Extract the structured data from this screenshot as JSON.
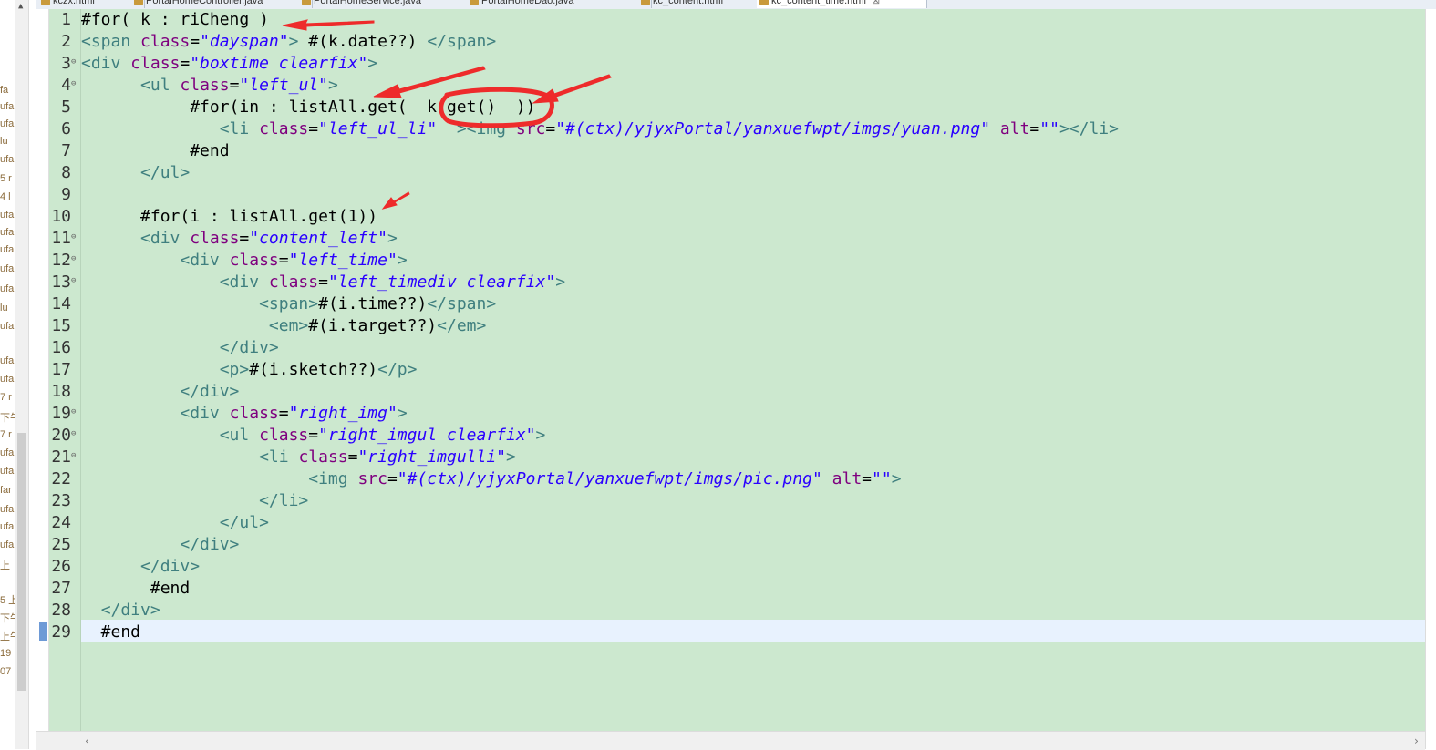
{
  "tabs": [
    {
      "label": "kczx.html",
      "active": false
    },
    {
      "label": "PortalHomeController.java",
      "active": false
    },
    {
      "label": "PortalHomeService.java",
      "active": false
    },
    {
      "label": "PortalHomeDao.java",
      "active": false
    },
    {
      "label": "kc_content.html",
      "active": false
    },
    {
      "label": "kc_content_time.html",
      "active": true
    }
  ],
  "left_strip_fragments": [
    "fa",
    "ufa",
    "ufa",
    "lu",
    "ufa",
    "5 r",
    "4 l",
    "ufa",
    "ufa",
    "ufa",
    "ufa",
    "ufa",
    "lu",
    "ufa",
    "ufa",
    "ufa",
    "7 r",
    "下午",
    "7 r",
    "ufa",
    "ufa",
    "far",
    "ufa",
    "ufa",
    "ufa",
    "上",
    "5 上",
    "下午",
    "上午",
    "19",
    "07"
  ],
  "editor": {
    "current_line": 29,
    "lines": [
      {
        "n": "1",
        "fold": "",
        "parts": [
          {
            "c": "plain",
            "t": "#for( k : riCheng )"
          }
        ]
      },
      {
        "n": "2",
        "fold": "",
        "parts": [
          {
            "c": "tag",
            "t": "<span "
          },
          {
            "c": "attr",
            "t": "class"
          },
          {
            "c": "plain",
            "t": "="
          },
          {
            "c": "str",
            "t": "\"dayspan\""
          },
          {
            "c": "tag",
            "t": ">"
          },
          {
            "c": "plain",
            "t": " #(k.date??) "
          },
          {
            "c": "tag",
            "t": "</span>"
          }
        ]
      },
      {
        "n": "3",
        "fold": "⊖",
        "parts": [
          {
            "c": "tag",
            "t": "<div "
          },
          {
            "c": "attr",
            "t": "class"
          },
          {
            "c": "plain",
            "t": "="
          },
          {
            "c": "str",
            "t": "\"boxtime clearfix\""
          },
          {
            "c": "tag",
            "t": ">"
          }
        ]
      },
      {
        "n": "4",
        "fold": "⊖",
        "parts": [
          {
            "c": "plain",
            "t": "      "
          },
          {
            "c": "tag",
            "t": "<ul "
          },
          {
            "c": "attr",
            "t": "class"
          },
          {
            "c": "plain",
            "t": "="
          },
          {
            "c": "str",
            "t": "\"left_ul\""
          },
          {
            "c": "tag",
            "t": ">"
          }
        ]
      },
      {
        "n": "5",
        "fold": "",
        "parts": [
          {
            "c": "plain",
            "t": "           #for(in : listAll.get(  k.get()  ))"
          }
        ]
      },
      {
        "n": "6",
        "fold": "",
        "parts": [
          {
            "c": "plain",
            "t": "              "
          },
          {
            "c": "tag",
            "t": "<li "
          },
          {
            "c": "attr",
            "t": "class"
          },
          {
            "c": "plain",
            "t": "="
          },
          {
            "c": "str",
            "t": "\"left_ul_li\""
          },
          {
            "c": "tag",
            "t": "  ><img "
          },
          {
            "c": "attr",
            "t": "src"
          },
          {
            "c": "plain",
            "t": "="
          },
          {
            "c": "str",
            "t": "\"#(ctx)/yjyxPortal/yanxuefwpt/imgs/yuan.png\""
          },
          {
            "c": "plain",
            "t": " "
          },
          {
            "c": "attr",
            "t": "alt"
          },
          {
            "c": "plain",
            "t": "="
          },
          {
            "c": "str",
            "t": "\"\""
          },
          {
            "c": "tag",
            "t": "></li>"
          }
        ]
      },
      {
        "n": "7",
        "fold": "",
        "parts": [
          {
            "c": "plain",
            "t": "           #end"
          }
        ]
      },
      {
        "n": "8",
        "fold": "",
        "parts": [
          {
            "c": "plain",
            "t": "      "
          },
          {
            "c": "tag",
            "t": "</ul>"
          }
        ]
      },
      {
        "n": "9",
        "fold": "",
        "parts": [
          {
            "c": "plain",
            "t": ""
          }
        ]
      },
      {
        "n": "10",
        "fold": "",
        "parts": [
          {
            "c": "plain",
            "t": "      #for(i : listAll.get(1))"
          }
        ]
      },
      {
        "n": "11",
        "fold": "⊖",
        "parts": [
          {
            "c": "plain",
            "t": "      "
          },
          {
            "c": "tag",
            "t": "<div "
          },
          {
            "c": "attr",
            "t": "class"
          },
          {
            "c": "plain",
            "t": "="
          },
          {
            "c": "str",
            "t": "\"content_left\""
          },
          {
            "c": "tag",
            "t": ">"
          }
        ]
      },
      {
        "n": "12",
        "fold": "⊖",
        "parts": [
          {
            "c": "plain",
            "t": "          "
          },
          {
            "c": "tag",
            "t": "<div "
          },
          {
            "c": "attr",
            "t": "class"
          },
          {
            "c": "plain",
            "t": "="
          },
          {
            "c": "str",
            "t": "\"left_time\""
          },
          {
            "c": "tag",
            "t": ">"
          }
        ]
      },
      {
        "n": "13",
        "fold": "⊖",
        "parts": [
          {
            "c": "plain",
            "t": "              "
          },
          {
            "c": "tag",
            "t": "<div "
          },
          {
            "c": "attr",
            "t": "class"
          },
          {
            "c": "plain",
            "t": "="
          },
          {
            "c": "str",
            "t": "\"left_timediv clearfix\""
          },
          {
            "c": "tag",
            "t": ">"
          }
        ]
      },
      {
        "n": "14",
        "fold": "",
        "parts": [
          {
            "c": "plain",
            "t": "                  "
          },
          {
            "c": "tag",
            "t": "<span>"
          },
          {
            "c": "plain",
            "t": "#(i.time??)"
          },
          {
            "c": "tag",
            "t": "</span>"
          }
        ]
      },
      {
        "n": "15",
        "fold": "",
        "parts": [
          {
            "c": "plain",
            "t": "                   "
          },
          {
            "c": "tag",
            "t": "<em>"
          },
          {
            "c": "plain",
            "t": "#(i.target??)"
          },
          {
            "c": "tag",
            "t": "</em>"
          }
        ]
      },
      {
        "n": "16",
        "fold": "",
        "parts": [
          {
            "c": "plain",
            "t": "              "
          },
          {
            "c": "tag",
            "t": "</div>"
          }
        ]
      },
      {
        "n": "17",
        "fold": "",
        "parts": [
          {
            "c": "plain",
            "t": "              "
          },
          {
            "c": "tag",
            "t": "<p>"
          },
          {
            "c": "plain",
            "t": "#(i.sketch??)"
          },
          {
            "c": "tag",
            "t": "</p>"
          }
        ]
      },
      {
        "n": "18",
        "fold": "",
        "parts": [
          {
            "c": "plain",
            "t": "          "
          },
          {
            "c": "tag",
            "t": "</div>"
          }
        ]
      },
      {
        "n": "19",
        "fold": "⊖",
        "parts": [
          {
            "c": "plain",
            "t": "          "
          },
          {
            "c": "tag",
            "t": "<div "
          },
          {
            "c": "attr",
            "t": "class"
          },
          {
            "c": "plain",
            "t": "="
          },
          {
            "c": "str",
            "t": "\"right_img\""
          },
          {
            "c": "tag",
            "t": ">"
          }
        ]
      },
      {
        "n": "20",
        "fold": "⊖",
        "parts": [
          {
            "c": "plain",
            "t": "              "
          },
          {
            "c": "tag",
            "t": "<ul "
          },
          {
            "c": "attr",
            "t": "class"
          },
          {
            "c": "plain",
            "t": "="
          },
          {
            "c": "str",
            "t": "\"right_imgul clearfix\""
          },
          {
            "c": "tag",
            "t": ">"
          }
        ]
      },
      {
        "n": "21",
        "fold": "⊖",
        "parts": [
          {
            "c": "plain",
            "t": "                  "
          },
          {
            "c": "tag",
            "t": "<li "
          },
          {
            "c": "attr",
            "t": "class"
          },
          {
            "c": "plain",
            "t": "="
          },
          {
            "c": "str",
            "t": "\"right_imgulli\""
          },
          {
            "c": "tag",
            "t": ">"
          }
        ]
      },
      {
        "n": "22",
        "fold": "",
        "parts": [
          {
            "c": "plain",
            "t": "                       "
          },
          {
            "c": "tag",
            "t": "<img "
          },
          {
            "c": "attr",
            "t": "src"
          },
          {
            "c": "plain",
            "t": "="
          },
          {
            "c": "str",
            "t": "\"#(ctx)/yjyxPortal/yanxuefwpt/imgs/pic.png\""
          },
          {
            "c": "plain",
            "t": " "
          },
          {
            "c": "attr",
            "t": "alt"
          },
          {
            "c": "plain",
            "t": "="
          },
          {
            "c": "str",
            "t": "\"\""
          },
          {
            "c": "tag",
            "t": ">"
          }
        ]
      },
      {
        "n": "23",
        "fold": "",
        "parts": [
          {
            "c": "plain",
            "t": "                  "
          },
          {
            "c": "tag",
            "t": "</li>"
          }
        ]
      },
      {
        "n": "24",
        "fold": "",
        "parts": [
          {
            "c": "plain",
            "t": "              "
          },
          {
            "c": "tag",
            "t": "</ul>"
          }
        ]
      },
      {
        "n": "25",
        "fold": "",
        "parts": [
          {
            "c": "plain",
            "t": "          "
          },
          {
            "c": "tag",
            "t": "</div>"
          }
        ]
      },
      {
        "n": "26",
        "fold": "",
        "parts": [
          {
            "c": "plain",
            "t": "      "
          },
          {
            "c": "tag",
            "t": "</div>"
          }
        ]
      },
      {
        "n": "27",
        "fold": "",
        "parts": [
          {
            "c": "plain",
            "t": "       #end"
          }
        ]
      },
      {
        "n": "28",
        "fold": "",
        "parts": [
          {
            "c": "plain",
            "t": "  "
          },
          {
            "c": "tag",
            "t": "</div>"
          }
        ]
      },
      {
        "n": "29",
        "fold": "",
        "parts": [
          {
            "c": "plain",
            "t": "  #end"
          }
        ]
      }
    ]
  },
  "colors": {
    "editor_bg": "#cce8cf",
    "current_line": "#e8f2fe",
    "tag": "#3f7f7f",
    "attribute": "#7f007f",
    "string": "#2a00ff",
    "annotation": "#ee2b2b"
  },
  "icons": {
    "tab_file": "java-file-icon",
    "fold_marker": "fold-collapse-icon",
    "scroll_left": "chevron-left-icon",
    "scroll_right": "chevron-right-icon"
  }
}
